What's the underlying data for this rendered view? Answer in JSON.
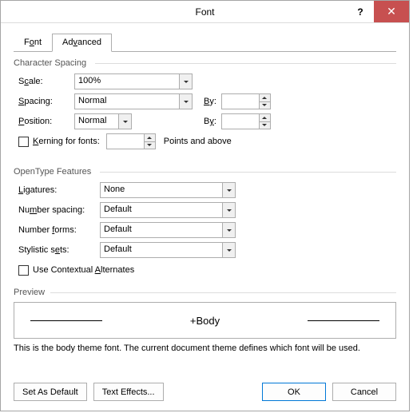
{
  "title": "Font",
  "help_icon": "?",
  "close_icon": "✕",
  "tabs": {
    "font": "Font",
    "advanced": "Advanced"
  },
  "charSpacing": {
    "group": "Character Spacing",
    "scale_lbl": "Scale:",
    "scale_val": "100%",
    "spacing_lbl": "Spacing:",
    "spacing_val": "Normal",
    "by1_lbl": "By:",
    "by1_val": "",
    "position_lbl": "Position:",
    "position_val": "Normal",
    "by2_lbl": "By:",
    "by2_val": "",
    "kerning_lbl": "Kerning for fonts:",
    "kerning_val": "",
    "kerning_unit": "Points and above"
  },
  "opentype": {
    "group": "OpenType Features",
    "ligatures_lbl": "Ligatures:",
    "ligatures_val": "None",
    "numspacing_lbl": "Number spacing:",
    "numspacing_val": "Default",
    "numforms_lbl": "Number forms:",
    "numforms_val": "Default",
    "stylsets_lbl": "Stylistic sets:",
    "stylsets_val": "Default",
    "contextual_lbl": "Use Contextual Alternates"
  },
  "preview": {
    "group": "Preview",
    "text": "+Body",
    "desc": "This is the body theme font. The current document theme defines which font will be used."
  },
  "footer": {
    "setdefault": "Set As Default",
    "texteffects": "Text Effects...",
    "ok": "OK",
    "cancel": "Cancel"
  }
}
